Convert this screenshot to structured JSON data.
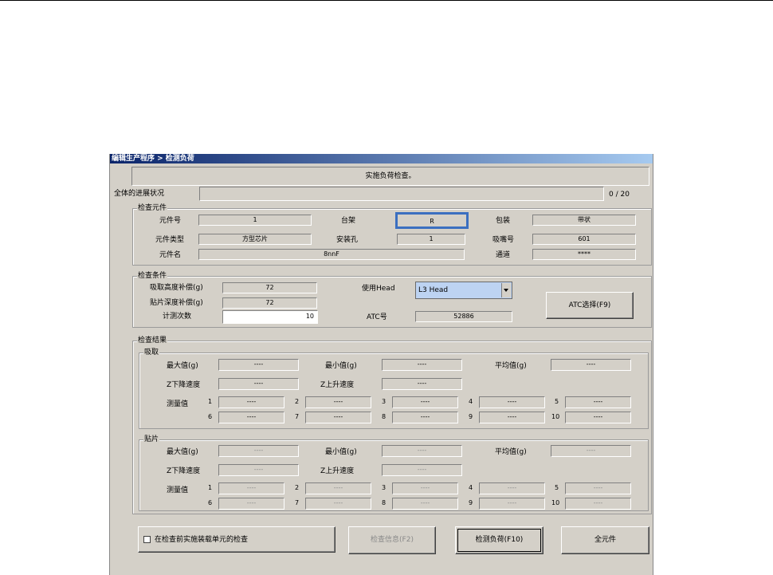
{
  "window": {
    "title": "编辑生产程序 > 检测负荷"
  },
  "banner": "实施负荷检查。",
  "progress": {
    "label": "全体的进展状况",
    "count": "0 / 20"
  },
  "component_group": {
    "caption": "检查元件",
    "component_no_label": "元件号",
    "component_no": "1",
    "rack_label": "台架",
    "rack": "R",
    "package_label": "包装",
    "package": "带状",
    "type_label": "元件类型",
    "type": "方型芯片",
    "hole_label": "安装孔",
    "hole": "1",
    "nozzle_label": "吸嘴号",
    "nozzle": "601",
    "name_label": "元件名",
    "name": "8nnF",
    "channel_label": "通道",
    "channel": "****"
  },
  "conditions": {
    "caption": "检查条件",
    "pick_height_label": "吸取高度补偿(g)",
    "pick_height": "72",
    "place_depth_label": "贴片深度补偿(g)",
    "place_depth": "72",
    "count_label": "计测次数",
    "count": "10",
    "head_label": "使用Head",
    "head": "L3 Head",
    "atc_label": "ATC号",
    "atc": "52886",
    "atc_button": "ATC选择(F9)"
  },
  "results": {
    "caption": "检查结果",
    "pick": {
      "caption": "吸取",
      "max_label": "最大值(g)",
      "max": "----",
      "min_label": "最小值(g)",
      "min": "----",
      "avg_label": "平均值(g)",
      "avg": "----",
      "zdown_label": "Z下降速度",
      "zdown": "----",
      "zup_label": "Z上升速度",
      "zup": "----",
      "measure_label": "测量值",
      "values": [
        "----",
        "----",
        "----",
        "----",
        "----",
        "----",
        "----",
        "----",
        "----",
        "----"
      ],
      "numbers": [
        "1",
        "2",
        "3",
        "4",
        "5",
        "6",
        "7",
        "8",
        "9",
        "10"
      ]
    },
    "place": {
      "caption": "贴片",
      "max_label": "最大值(g)",
      "max": "----",
      "min_label": "最小值(g)",
      "min": "----",
      "avg_label": "平均值(g)",
      "avg": "----",
      "zdown_label": "Z下降速度",
      "zdown": "----",
      "zup_label": "Z上升速度",
      "zup": "----",
      "measure_label": "测量值",
      "values": [
        "----",
        "----",
        "----",
        "----",
        "----",
        "----",
        "----",
        "----",
        "----",
        "----"
      ],
      "numbers": [
        "1",
        "2",
        "3",
        "4",
        "5",
        "6",
        "7",
        "8",
        "9",
        "10"
      ]
    }
  },
  "footer": {
    "checkbox_label": "在检查前实施装载单元的检查",
    "check_info_button": "检查信息(F2)",
    "load_button": "检测负荷(F10)",
    "all_button": "全元件"
  }
}
